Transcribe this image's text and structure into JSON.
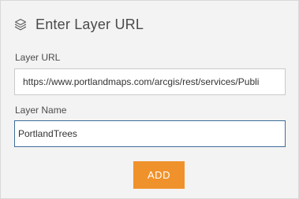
{
  "dialog": {
    "title": "Enter Layer URL",
    "icon": "layers-icon"
  },
  "layer_url": {
    "label": "Layer URL",
    "value": "https://www.portlandmaps.com/arcgis/rest/services/Publi​"
  },
  "layer_name": {
    "label": "Layer Name",
    "value": "PortlandTrees"
  },
  "actions": {
    "add_label": "ADD"
  },
  "colors": {
    "panel_bg": "#f3f3f3",
    "button_bg": "#f0922b",
    "active_border": "#3f6d9b"
  }
}
